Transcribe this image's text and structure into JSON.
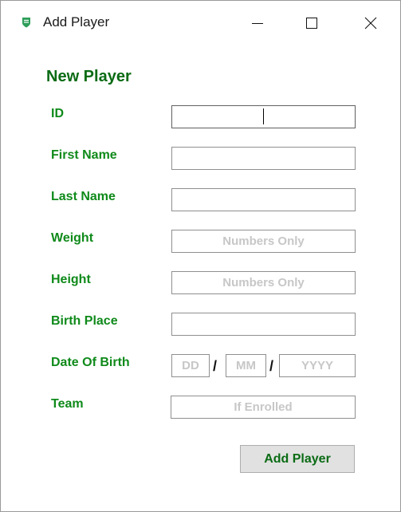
{
  "window": {
    "title": "Add Player",
    "accent_color": "#0f8a1a"
  },
  "form": {
    "heading": "New Player",
    "fields": {
      "id": {
        "label": "ID",
        "value": "",
        "placeholder": ""
      },
      "first_name": {
        "label": "First Name",
        "value": "",
        "placeholder": ""
      },
      "last_name": {
        "label": "Last Name",
        "value": "",
        "placeholder": ""
      },
      "weight": {
        "label": "Weight",
        "value": "",
        "placeholder": "Numbers Only"
      },
      "height": {
        "label": "Height",
        "value": "",
        "placeholder": "Numbers Only"
      },
      "birth_place": {
        "label": "Birth Place",
        "value": "",
        "placeholder": ""
      },
      "date_of_birth": {
        "label": "Date Of Birth",
        "day_placeholder": "DD",
        "month_placeholder": "MM",
        "year_placeholder": "YYYY",
        "separator": "/"
      },
      "team": {
        "label": "Team",
        "value": "",
        "placeholder": "If Enrolled"
      }
    },
    "submit_label": "Add Player"
  },
  "icons": {
    "app": "shield-icon",
    "minimize": "minimize-icon",
    "maximize": "maximize-icon",
    "close": "close-icon"
  }
}
